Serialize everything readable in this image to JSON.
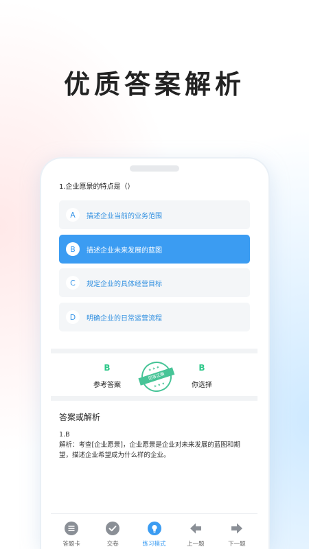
{
  "headline": "优质答案解析",
  "question": "1.企业愿景的特点是（）",
  "options": [
    {
      "letter": "A",
      "text": "描述企业当前的业务范围",
      "selected": false
    },
    {
      "letter": "B",
      "text": "描述企业未来发展的蓝图",
      "selected": true
    },
    {
      "letter": "C",
      "text": "规定企业的具体经营目标",
      "selected": false
    },
    {
      "letter": "D",
      "text": "明确企业的日常运营流程",
      "selected": false
    }
  ],
  "answer": {
    "reference_letter": "B",
    "reference_label": "参考答案",
    "chosen_letter": "B",
    "chosen_label": "你选择",
    "stamp_text": "回答正确"
  },
  "analysis": {
    "title": "答案或解析",
    "line1": "1.B",
    "line2": "解析：考查[企业愿景]，企业愿景是企业对未来发展的蓝图和期望，描述企业希望成为什么样的企业。"
  },
  "tabs": [
    {
      "label": "答题卡",
      "icon": "list-icon",
      "active": false
    },
    {
      "label": "交卷",
      "icon": "check-circle-icon",
      "active": false
    },
    {
      "label": "练习模式",
      "icon": "lightbulb-icon",
      "active": true
    },
    {
      "label": "上一题",
      "icon": "arrow-left-icon",
      "active": false
    },
    {
      "label": "下一题",
      "icon": "arrow-right-icon",
      "active": false
    }
  ],
  "colors": {
    "accent": "#3b9cf2",
    "correct": "#2fc88a",
    "icon_gray": "#8a8f96"
  }
}
